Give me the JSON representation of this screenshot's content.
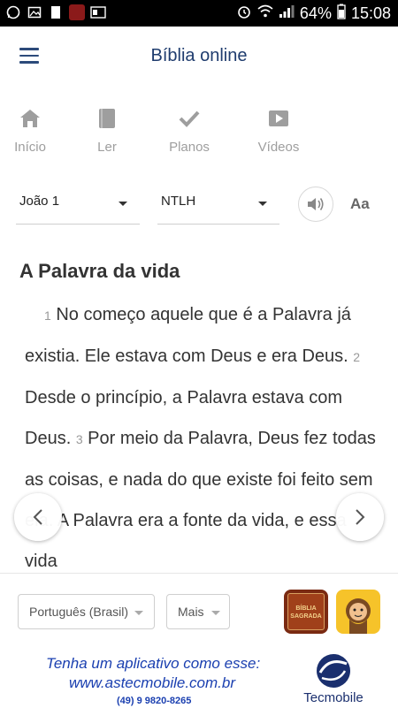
{
  "status_bar": {
    "battery": "64%",
    "time": "15:08"
  },
  "header": {
    "title": "Bíblia online"
  },
  "nav": [
    {
      "label": "Início",
      "icon": "home-icon"
    },
    {
      "label": "Ler",
      "icon": "book-icon"
    },
    {
      "label": "Planos",
      "icon": "check-icon"
    },
    {
      "label": "Vídeos",
      "icon": "play-icon"
    }
  ],
  "selectors": {
    "book_chapter": "João 1",
    "version": "NTLH",
    "font_label": "Aa"
  },
  "content": {
    "heading": "A Palavra da vida",
    "v1_num": "1",
    "v1_text": " No começo aquele que é a Palavra já existia. Ele estava com Deus e era Deus. ",
    "v2_num": "2",
    "v2_text": " Desde o princípio, a Palavra estava com Deus. ",
    "v3_num": "3",
    "v3_text": " Por meio da Palavra, Deus fez todas as coisas, e nada do que existe foi feito sem ela. ",
    "v4_text": "A Palavra era a fonte da vida, e essa vida"
  },
  "footer": {
    "language": "Português (Brasil)",
    "more": "Mais",
    "ad_line1": "Tenha um aplicativo como esse:",
    "ad_line2": "www.astecmobile.com.br",
    "ad_phone": "(49) 9 9820-8265",
    "brand": "Tecmobile",
    "bible_app_label_1": "BÍBLIA",
    "bible_app_label_2": "SAGRADA"
  },
  "colors": {
    "title": "#1f3c6e",
    "nav_inactive": "#9e9e9e",
    "ad_blue": "#1a3fb0"
  }
}
